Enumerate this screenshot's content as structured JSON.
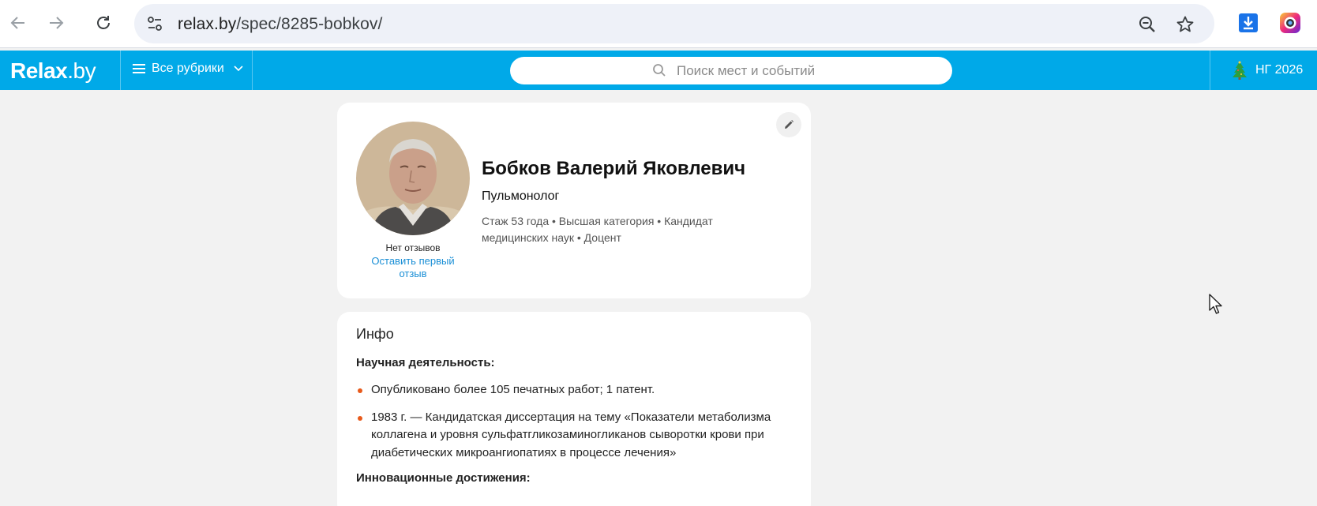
{
  "browser": {
    "url_host": "relax.by",
    "url_path": "/spec/8285-bobkov/"
  },
  "site": {
    "logo_main": "Relax",
    "logo_suffix": ".by",
    "rubrics_label": "Все рубрики",
    "search_placeholder": "Поиск мест и событий",
    "ng_label": "НГ 2026",
    "brand_color": "#00a9e8"
  },
  "profile": {
    "name": "Бобков Валерий Яковлевич",
    "specialty": "Пульмонолог",
    "meta": "Стаж 53 года  •  Высшая категория • Кандидат медицинских наук • Доцент",
    "reviews_none": "Нет отзывов",
    "review_link": "Оставить первый отзыв"
  },
  "info": {
    "title": "Инфо",
    "science_heading": "Научная деятельность:",
    "science_items": [
      "Опубликовано более 105 печатных работ; 1 патент.",
      "1983 г. — Кандидатская диссертация на тему «Показатели метаболизма коллагена и уровня сульфатгликозаминогликанов сыворотки крови при диабетических микроангиопатиях в процессе лечения»"
    ],
    "innovation_heading": "Инновационные достижения:"
  }
}
